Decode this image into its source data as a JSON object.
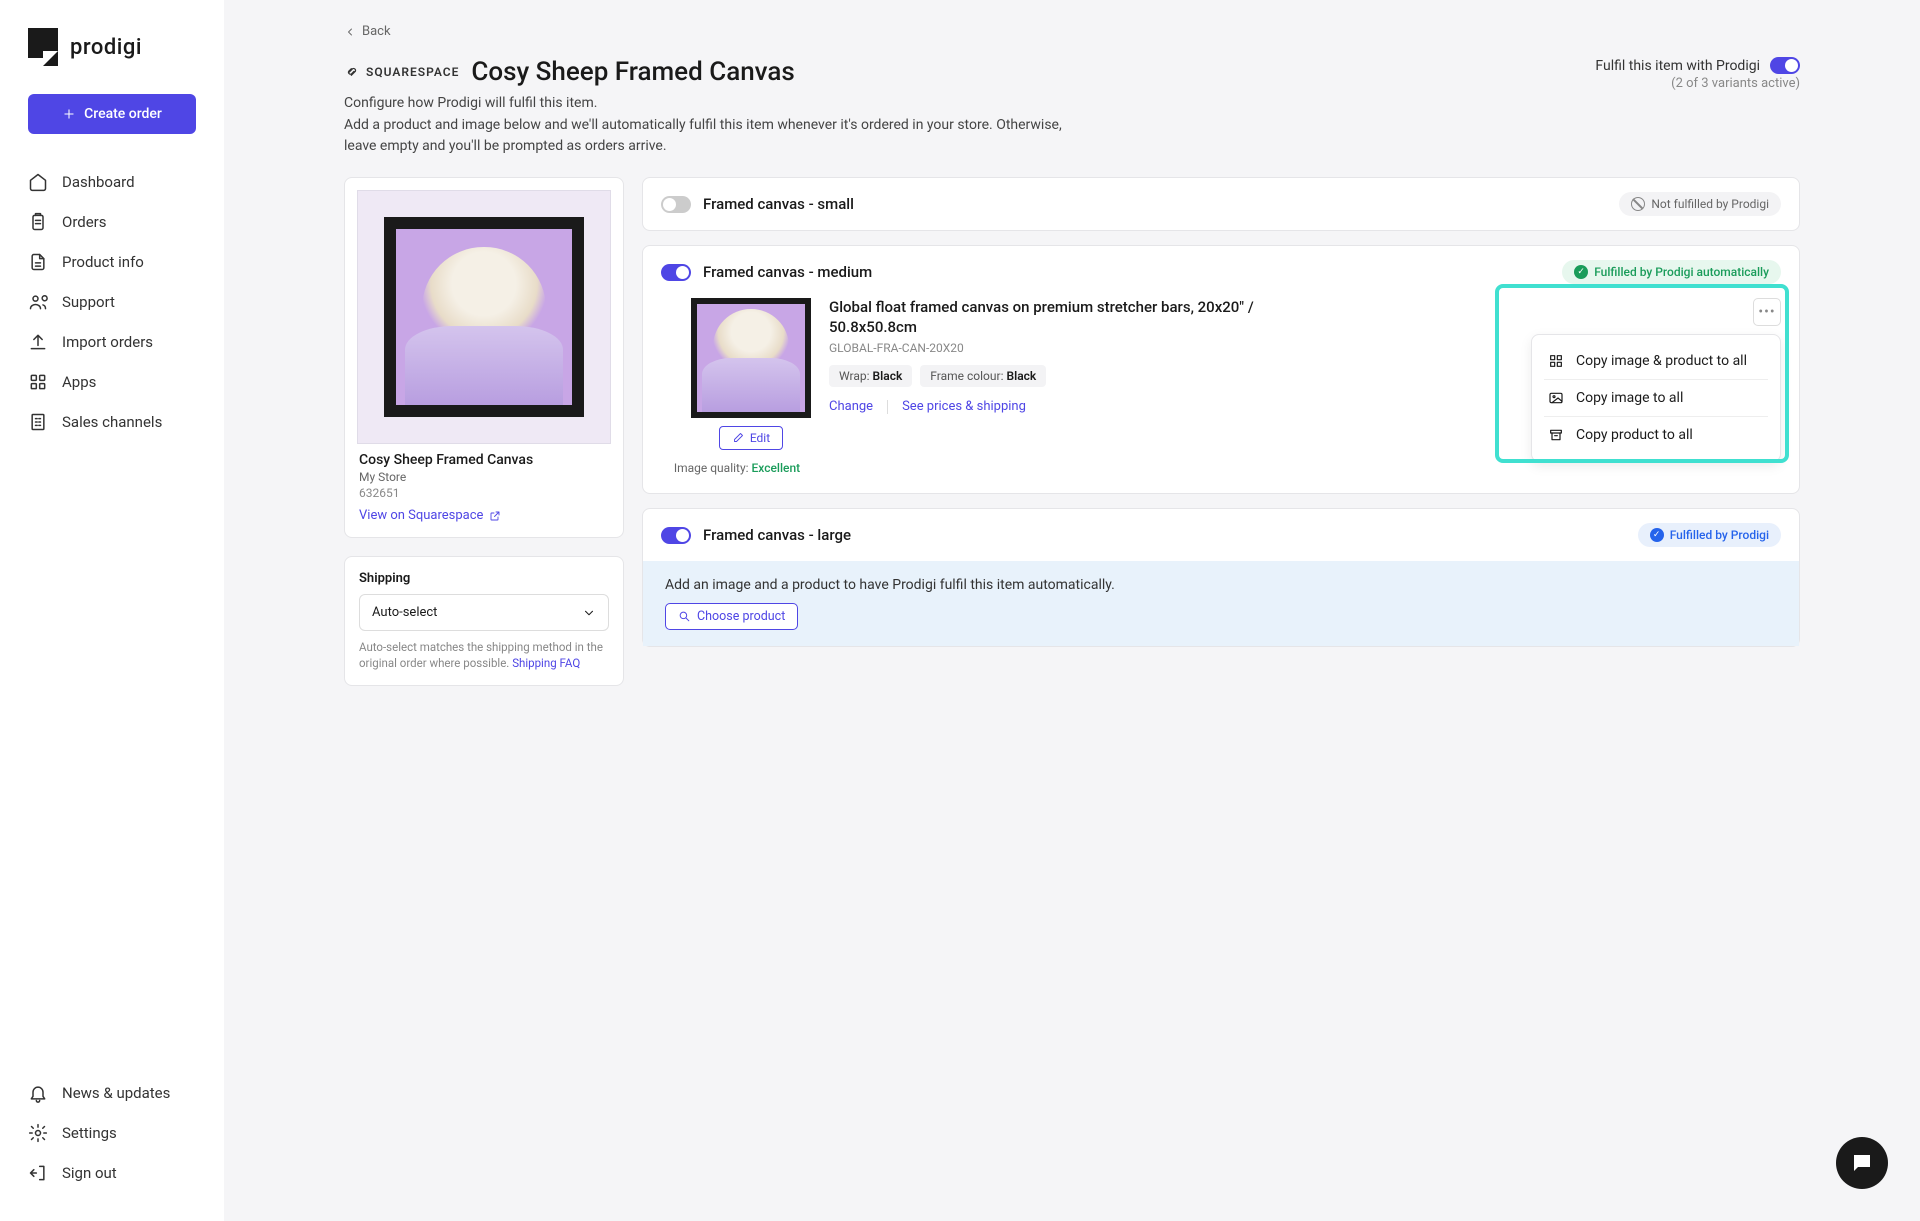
{
  "brand": "prodigi",
  "sidebar": {
    "create_order": "Create order",
    "nav": {
      "dashboard": "Dashboard",
      "orders": "Orders",
      "product_info": "Product info",
      "support": "Support",
      "import_orders": "Import orders",
      "apps": "Apps",
      "sales_channels": "Sales channels"
    },
    "bottom": {
      "news": "News & updates",
      "settings": "Settings",
      "signout": "Sign out"
    }
  },
  "back": "Back",
  "platform_badge": "SQUARESPACE",
  "page_title": "Cosy Sheep Framed Canvas",
  "subtitle": "Configure how Prodigi will fulfil this item.",
  "description": "Add a product and image below and we'll automatically fulfil this item whenever it's ordered in your store. Otherwise, leave empty and you'll be prompted as orders arrive.",
  "fulfil_toggle_label": "Fulfil this item with Prodigi",
  "variants_active": "(2 of 3 variants active)",
  "product": {
    "name": "Cosy Sheep Framed Canvas",
    "store": "My Store",
    "id": "632651",
    "view_link": "View on Squarespace"
  },
  "shipping": {
    "label": "Shipping",
    "value": "Auto-select",
    "note_pre": "Auto-select matches the shipping method in the original order where possible. ",
    "faq": "Shipping FAQ"
  },
  "variants": {
    "small": {
      "name": "Framed canvas - small",
      "status": "Not fulfilled by Prodigi"
    },
    "medium": {
      "name": "Framed canvas - medium",
      "status": "Fulfilled by Prodigi automatically",
      "description": "Global float framed canvas on premium stretcher bars, 20x20\" / 50.8x50.8cm",
      "sku": "GLOBAL-FRA-CAN-20X20",
      "wrap_label": "Wrap:",
      "wrap_val": "Black",
      "frame_label": "Frame colour:",
      "frame_val": "Black",
      "change": "Change",
      "prices": "See prices & shipping",
      "edit": "Edit",
      "quality_label": "Image quality: ",
      "quality_val": "Excellent"
    },
    "large": {
      "name": "Framed canvas - large",
      "status": "Fulfilled by Prodigi",
      "add_hint": "Add an image and a product to have Prodigi fulfil this item automatically.",
      "choose": "Choose product"
    }
  },
  "dropdown": {
    "copy_all": "Copy image & product to all",
    "copy_image": "Copy image to all",
    "copy_product": "Copy product to all"
  }
}
